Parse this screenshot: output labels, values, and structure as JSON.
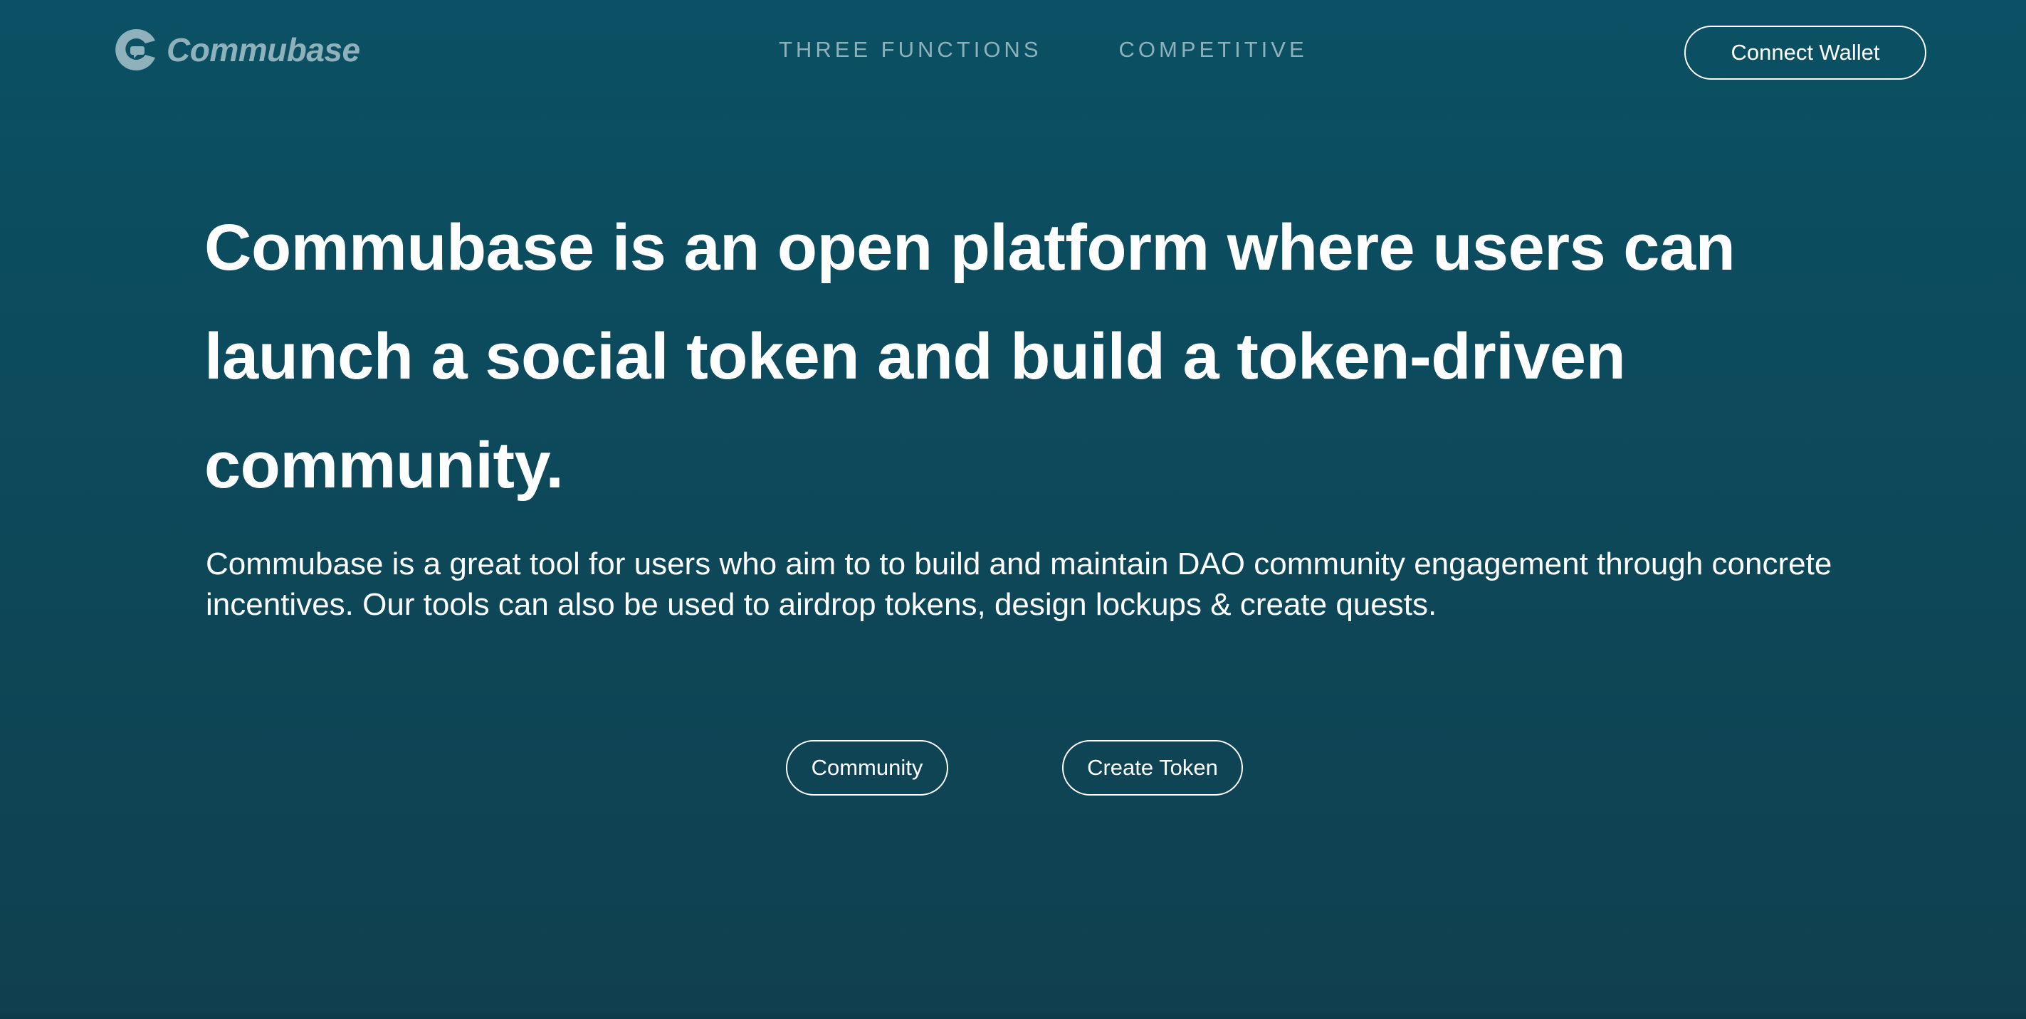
{
  "brand": {
    "name": "Commubase",
    "logo_icon": "commubase-logo-icon",
    "logo_color": "#8fb1bb"
  },
  "nav": {
    "items": [
      {
        "label": "THREE FUNCTIONS"
      },
      {
        "label": "COMPETITIVE"
      }
    ]
  },
  "header": {
    "connect_wallet_label": "Connect Wallet"
  },
  "hero": {
    "title": "Commubase is an open platform where users can launch a social token and build a token-driven community.",
    "description": "Commubase is a great tool for users who aim to to build and maintain DAO community engagement through concrete incentives. Our tools can also be used to airdrop tokens, design lockups & create quests.",
    "buttons": [
      {
        "label": "Community"
      },
      {
        "label": "Create Token"
      }
    ]
  },
  "colors": {
    "background_top": "#0b5064",
    "background_bottom": "#10404f",
    "nav_text": "#8fb1bb",
    "text": "#ffffff"
  }
}
